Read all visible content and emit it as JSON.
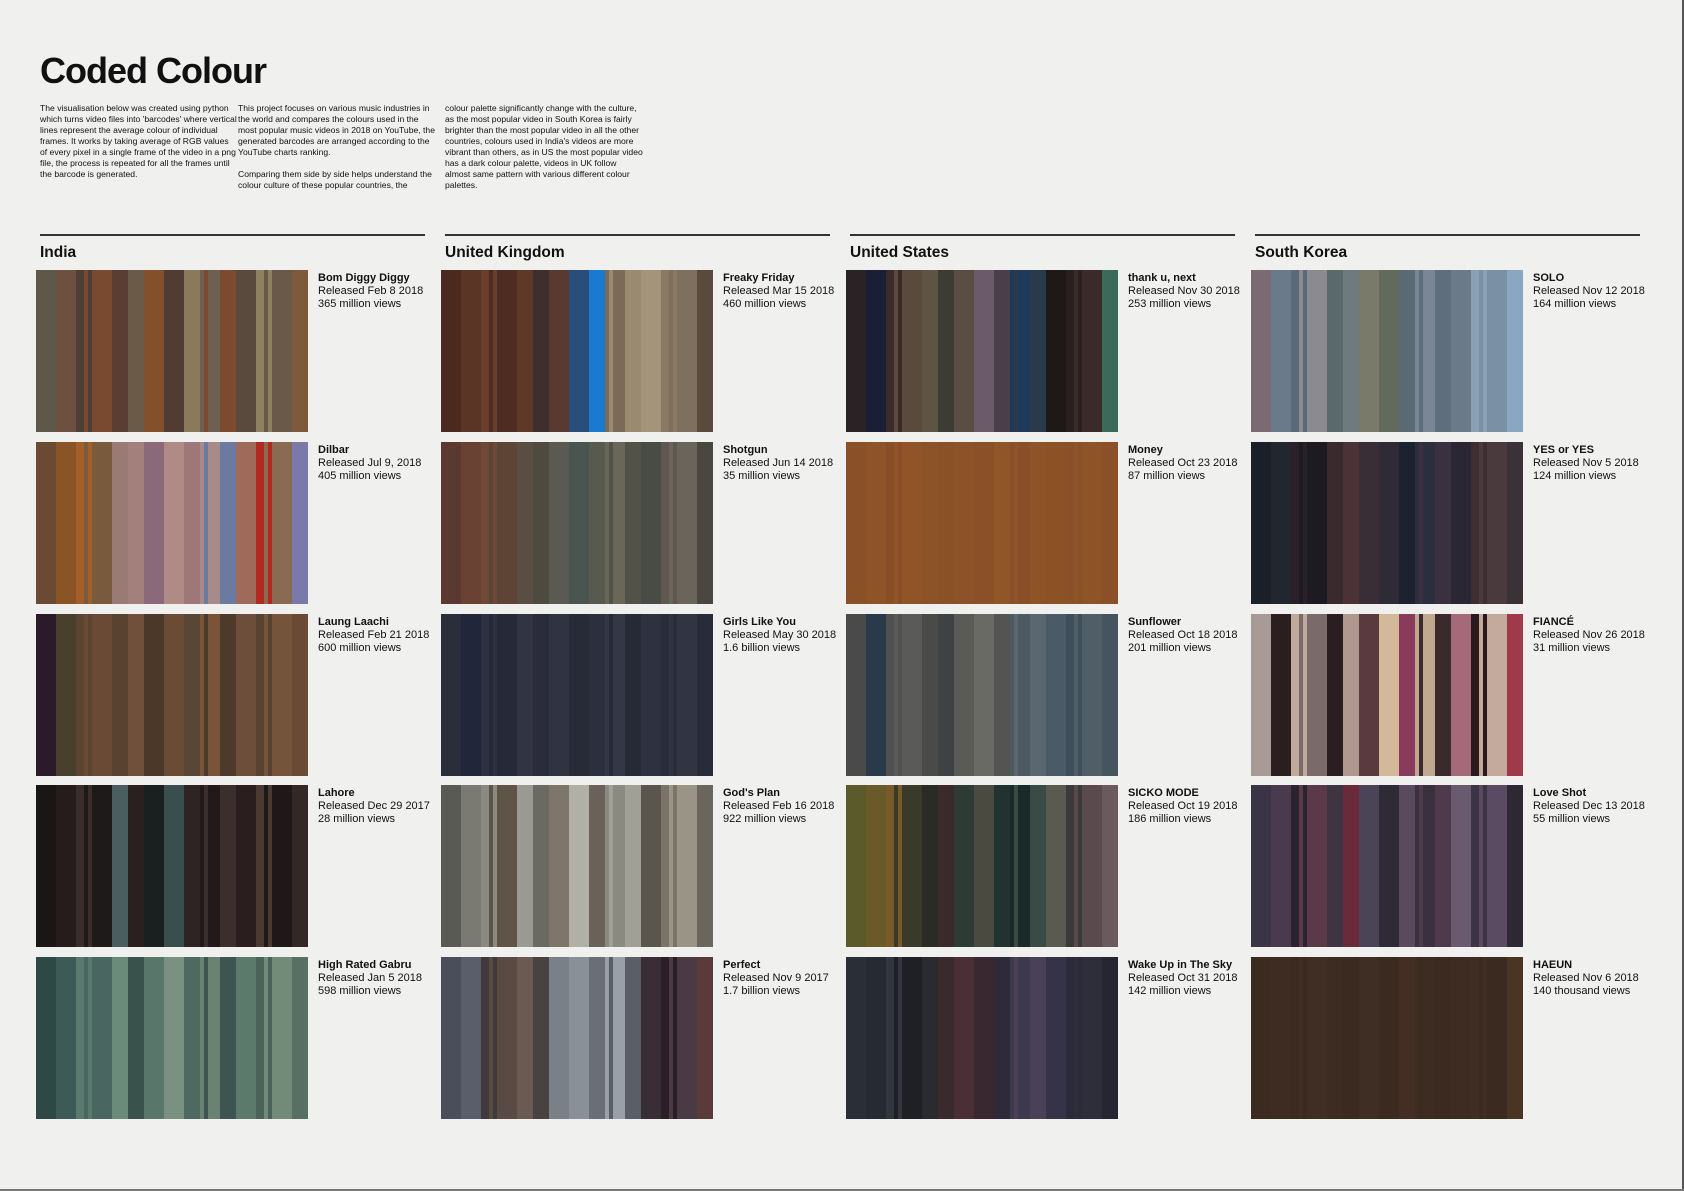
{
  "title": "Coded Colour",
  "intro": [
    "The visualisation below was created using python which turns video files into 'barcodes' where vertical lines represent the average colour of individual frames. It works by taking average of RGB values of every pixel in a single frame of the video in a png file, the process is repeated for all the frames until the barcode is generated.",
    "This project focuses on various music industries in the world and compares the colours used in the most popular music videos in 2018 on YouTube, the generated barcodes are arranged according to the YouTube charts ranking.",
    "Comparing them side by side helps understand the colour culture of these popular countries, the",
    "colour palette significantly change with the culture, as the most popular video in South Korea is fairly brighter than the most popular video in all the other countries, colours used in India's videos are more vibrant than others, as in US the most popular video has a dark colour palette, videos in UK follow almost same pattern with various different colour palettes."
  ],
  "countries": [
    {
      "name": "India",
      "songs": [
        {
          "title": "Bom Diggy Diggy",
          "released": "Released Feb 8 2018",
          "views": "365 million views",
          "palette": [
            "#5e5848",
            "#6e5040",
            "#4c4036",
            "#7a4a30",
            "#5a3e34",
            "#6a5a48",
            "#84502c",
            "#503c32",
            "#8a7a5c",
            "#6e6050",
            "#7c4a2e",
            "#5a4a3e",
            "#8c8260",
            "#6a5848",
            "#7e5a3a"
          ]
        },
        {
          "title": "Dilbar",
          "released": "Released Jul 9, 2018",
          "views": "405 million views",
          "palette": [
            "#6a4a32",
            "#8a5426",
            "#a45e28",
            "#7a5a3c",
            "#9a7a74",
            "#a4807c",
            "#8a6a7a",
            "#b08a84",
            "#9e7878",
            "#a88a88",
            "#6a7aa0",
            "#a06a5a",
            "#b02a20",
            "#8a6a52",
            "#7a7aaa"
          ]
        },
        {
          "title": "Laung Laachi",
          "released": "Released Feb 21 2018",
          "views": "600 million views",
          "palette": [
            "#2a1a2a",
            "#4a3e2c",
            "#5c4432",
            "#6a4a34",
            "#5a4230",
            "#70503a",
            "#4c3828",
            "#6a4c36",
            "#5a4634",
            "#7a5438",
            "#4e3a2a",
            "#6c4e3a",
            "#584232",
            "#76543a",
            "#6a4a34"
          ]
        },
        {
          "title": "Lahore",
          "released": "Released Dec 29 2017",
          "views": "28 million views",
          "palette": [
            "#1a1616",
            "#261c1c",
            "#3a2e2a",
            "#1e1a1a",
            "#4a5e60",
            "#2a2020",
            "#182020",
            "#3a4e50",
            "#2e2424",
            "#221a1a",
            "#3c2e2a",
            "#2a1e1e",
            "#4a3a32",
            "#1e1818",
            "#342826"
          ]
        },
        {
          "title": "High Rated Gabru",
          "released": "Released Jan 5 2018",
          "views": "598 million views",
          "palette": [
            "#2e4846",
            "#3e5a56",
            "#5a7a6e",
            "#4a6660",
            "#6a8a7a",
            "#3a524c",
            "#58766a",
            "#7a9080",
            "#4e6a60",
            "#6a8272",
            "#3e5450",
            "#5c7a6c",
            "#4a6258",
            "#728a78",
            "#587064"
          ]
        }
      ]
    },
    {
      "name": "United Kingdom",
      "songs": [
        {
          "title": "Freaky Friday",
          "released": "Released Mar 15 2018",
          "views": "460 million views",
          "palette": [
            "#4a2a1e",
            "#5a3424",
            "#6a3e2a",
            "#4e2c22",
            "#603828",
            "#3e2e2c",
            "#5a3a30",
            "#2a4e7a",
            "#1a7ad0",
            "#7a6a58",
            "#9a8a70",
            "#a4957a",
            "#8a7a64",
            "#7e705e",
            "#5a4a3e"
          ]
        },
        {
          "title": "Shotgun",
          "released": "Released Jun 14 2018",
          "views": "35 million views",
          "palette": [
            "#5a3a30",
            "#6a4234",
            "#704838",
            "#5e4434",
            "#5a4e42",
            "#4e4a40",
            "#5a5a52",
            "#4a5450",
            "#585a50",
            "#6a6658",
            "#525248",
            "#484c44",
            "#5e5850",
            "#6a645a",
            "#4a4640"
          ]
        },
        {
          "title": "Girls Like You",
          "released": "Released May 30 2018",
          "views": "1.6 billion views",
          "palette": [
            "#2a2e3a",
            "#22263a",
            "#2e3240",
            "#262a38",
            "#323444",
            "#2a2c3c",
            "#303442",
            "#282a38",
            "#2c303e",
            "#343846",
            "#262a36",
            "#2e3240",
            "#2a2e3c",
            "#323442",
            "#282c3a"
          ]
        },
        {
          "title": "God's Plan",
          "released": "Released Feb 16 2018",
          "views": "922 million views",
          "palette": [
            "#5a5a54",
            "#7a7a72",
            "#8a8a82",
            "#5e5448",
            "#9a9a92",
            "#6a6a62",
            "#7e766a",
            "#b0b0a6",
            "#6a6258",
            "#8a8a80",
            "#a0a096",
            "#5a564e",
            "#7a7468",
            "#9a9486",
            "#6a665e"
          ]
        },
        {
          "title": "Perfect",
          "released": "Released Nov 9 2017",
          "views": "1.7 billion views",
          "palette": [
            "#4a4e5a",
            "#5a5e6a",
            "#3e3a3e",
            "#5a4a44",
            "#6a5a52",
            "#4a4240",
            "#7a8088",
            "#8a9098",
            "#6a6e76",
            "#9aa0a8",
            "#5a5e66",
            "#3a2e36",
            "#2a1e28",
            "#4a3a44",
            "#5a3a3a"
          ]
        }
      ]
    },
    {
      "name": "United States",
      "songs": [
        {
          "title": "thank u, next",
          "released": "Released Nov 30 2018",
          "views": "253 million views",
          "palette": [
            "#2a2224",
            "#1a1e36",
            "#3a2a2a",
            "#5a4a3e",
            "#5e5444",
            "#3e3a34",
            "#5a4e44",
            "#6a5a6a",
            "#4a3e4a",
            "#1e3a5a",
            "#2a3a4a",
            "#1e1816",
            "#2a2020",
            "#3a2a2a",
            "#3a6a5a"
          ]
        },
        {
          "title": "Money",
          "released": "Released Oct 23 2018",
          "views": "87 million views",
          "palette": [
            "#8a5028",
            "#8e5428",
            "#8a4e26",
            "#905428",
            "#8c5228",
            "#8a5026",
            "#8e5228",
            "#8c5028",
            "#905628",
            "#8a4e28",
            "#8e5428",
            "#8c5226",
            "#8a5028",
            "#8e5428",
            "#8c5028"
          ]
        },
        {
          "title": "Sunflower",
          "released": "Released Oct 18 2018",
          "views": "201 million views",
          "palette": [
            "#4a4a4a",
            "#2a3a4a",
            "#505050",
            "#5a5a58",
            "#4a4a48",
            "#3e4244",
            "#5a5a56",
            "#6a6a64",
            "#545452",
            "#4e5a62",
            "#5a6670",
            "#4a5a66",
            "#3e4e5a",
            "#505e68",
            "#465460"
          ]
        },
        {
          "title": "SICKO MODE",
          "released": "Released Oct 19 2018",
          "views": "186 million views",
          "palette": [
            "#5a5a2a",
            "#6a5a2a",
            "#7a5a28",
            "#3a3a2a",
            "#2a2a26",
            "#3a2a2a",
            "#2e3a34",
            "#4a4a40",
            "#223230",
            "#1a2a2a",
            "#3a4a44",
            "#5a5a50",
            "#3a3a38",
            "#5a4a4e",
            "#6a5a5e"
          ]
        },
        {
          "title": "Wake Up in The Sky",
          "released": "Released Oct 31 2018",
          "views": "142 million views",
          "palette": [
            "#2a2e36",
            "#262a32",
            "#32363e",
            "#1e2026",
            "#2a2a30",
            "#3a2a2e",
            "#4a3036",
            "#3a2830",
            "#2e2a3a",
            "#3e3a4e",
            "#4a4058",
            "#363248",
            "#2a2a3a",
            "#2e2e3a",
            "#262632"
          ]
        }
      ]
    },
    {
      "name": "South Korea",
      "songs": [
        {
          "title": "SOLO",
          "released": "Released Nov 12 2018",
          "views": "164 million views",
          "palette": [
            "#7a6a72",
            "#6a7a8a",
            "#5a6a78",
            "#8a8a90",
            "#5a6a6a",
            "#6e7a7e",
            "#7a7a6a",
            "#626a5e",
            "#5a6a72",
            "#7a8696",
            "#5e6e7a",
            "#6a7a88",
            "#8aa0b4",
            "#7a90a4",
            "#8aa6c0"
          ]
        },
        {
          "title": "YES or YES",
          "released": "Released Nov 5 2018",
          "views": "124 million views",
          "palette": [
            "#1a2028",
            "#22262e",
            "#2a2028",
            "#1e1a22",
            "#3a2a2e",
            "#4a3236",
            "#3a2e36",
            "#2e2a36",
            "#1e2230",
            "#2a2e3e",
            "#3a3040",
            "#2a2634",
            "#3e2e32",
            "#4a3a3e",
            "#3a3236"
          ]
        },
        {
          "title": "FIANCÉ",
          "released": "Released Nov 26 2018",
          "views": "31 million views",
          "palette": [
            "#a89a94",
            "#2a1e1e",
            "#c0a89a",
            "#7a6a6a",
            "#2a1e22",
            "#b0988e",
            "#5a3a3e",
            "#d4b89a",
            "#8a3a5a",
            "#c0a890",
            "#3a2a2e",
            "#a46a7a",
            "#2a1a1e",
            "#c4aa9a",
            "#a03a4a"
          ]
        },
        {
          "title": "Love Shot",
          "released": "Released Dec 13 2018",
          "views": "55 million views",
          "palette": [
            "#3a3446",
            "#4a3a4e",
            "#2a2430",
            "#5a3a48",
            "#3e3442",
            "#6a2a3a",
            "#4a4456",
            "#2e2a36",
            "#5a4a5e",
            "#3a3040",
            "#4e3a4a",
            "#6a5a70",
            "#3a3444",
            "#5a4a62",
            "#2e2834"
          ]
        },
        {
          "title": "HAEUN",
          "released": "Released Nov 6 2018",
          "views": "140 thousand views",
          "palette": [
            "#3a2a20",
            "#3e2c22",
            "#3a2a20",
            "#402e24",
            "#3c2c22",
            "#3a2a20",
            "#3e2e24",
            "#3a2a20",
            "#442e24",
            "#3c2c22",
            "#3a2a20",
            "#3e2c22",
            "#402e24",
            "#3a2a20",
            "#4a3424"
          ]
        }
      ]
    }
  ]
}
